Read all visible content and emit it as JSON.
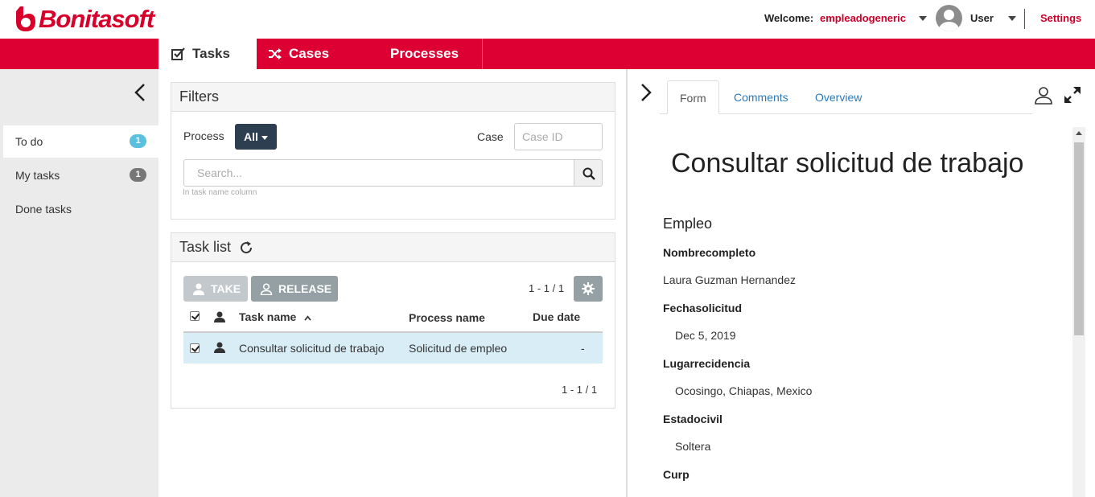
{
  "header": {
    "logo_text": "Bonitasoft",
    "welcome_label": "Welcome:",
    "username": "empleadogeneric",
    "user_menu_label": "User",
    "settings_label": "Settings",
    "brand_color": "#dd0033"
  },
  "nav": {
    "tabs": [
      {
        "label": "Tasks",
        "active": true,
        "icon": "check-square-icon"
      },
      {
        "label": "Cases",
        "active": false,
        "icon": "shuffle-icon"
      },
      {
        "label": "Processes",
        "active": false
      }
    ]
  },
  "sidebar": {
    "items": [
      {
        "label": "To do",
        "badge": "1",
        "active": true
      },
      {
        "label": "My tasks",
        "badge": "1",
        "active": false
      },
      {
        "label": "Done tasks",
        "active": false
      }
    ]
  },
  "filters": {
    "title": "Filters",
    "process_label": "Process",
    "process_value": "All",
    "case_label": "Case",
    "case_placeholder": "Case ID",
    "search_placeholder": "Search...",
    "search_hint": "In task name column"
  },
  "tasklist": {
    "title": "Task list",
    "take_label": "TAKE",
    "release_label": "RELEASE",
    "pager_top": "1 - 1 / 1",
    "pager_bottom": "1 - 1 / 1",
    "columns": [
      "Task name",
      "Process name",
      "Due date"
    ],
    "rows": [
      {
        "task_name": "Consultar solicitud de trabajo",
        "process_name": "Solicitud de empleo",
        "due_date": "-",
        "checked": true
      }
    ]
  },
  "detail": {
    "tabs": [
      {
        "label": "Form",
        "active": true
      },
      {
        "label": "Comments",
        "active": false
      },
      {
        "label": "Overview",
        "active": false
      }
    ],
    "form_title": "Consultar solicitud de trabajo",
    "section_title": "Empleo",
    "fields": [
      {
        "label": "Nombrecompleto",
        "value": "Laura Guzman Hernandez"
      },
      {
        "label": "Fechasolicitud",
        "value": "Dec 5, 2019"
      },
      {
        "label": "Lugarrecidencia",
        "value": "Ocosingo, Chiapas, Mexico"
      },
      {
        "label": "Estadocivil",
        "value": "Soltera"
      },
      {
        "label": "Curp",
        "value": ""
      }
    ]
  }
}
